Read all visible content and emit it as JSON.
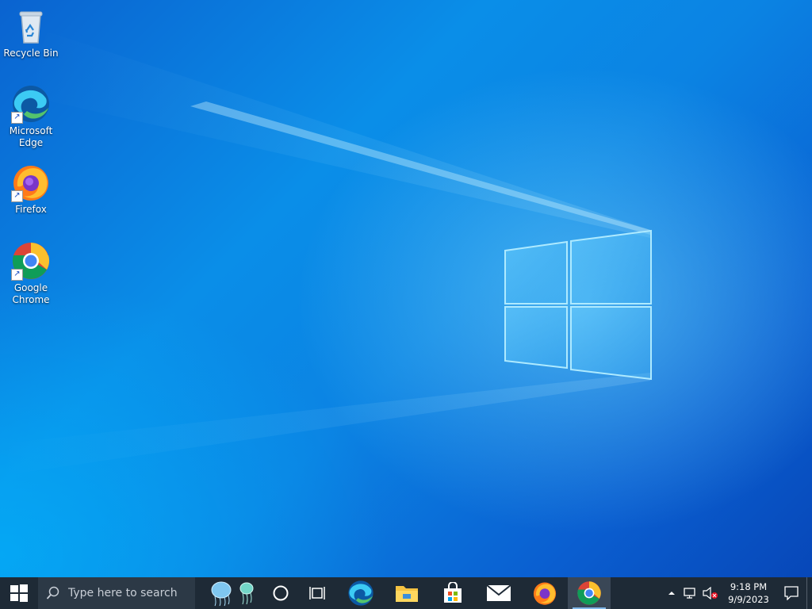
{
  "desktop": {
    "icons": [
      {
        "label_line1": "Recycle Bin",
        "label_line2": "",
        "icon": "recycle-bin-icon"
      },
      {
        "label_line1": "Microsoft",
        "label_line2": "Edge",
        "icon": "edge-icon"
      },
      {
        "label_line1": "Firefox",
        "label_line2": "",
        "icon": "firefox-icon"
      },
      {
        "label_line1": "Google",
        "label_line2": "Chrome",
        "icon": "chrome-icon"
      }
    ]
  },
  "taskbar": {
    "start_icon": "windows-start-icon",
    "search_placeholder": "Type here to search",
    "pinned": [
      "cortana-icon",
      "task-view-icon",
      "edge-icon",
      "file-explorer-icon",
      "microsoft-store-icon",
      "mail-icon",
      "firefox-icon",
      "chrome-icon"
    ],
    "active_app": "chrome-icon",
    "colors": {
      "taskbar_bg": "#1e2a36",
      "search_bg": "#2c3946",
      "active_indicator": "#7fb6e8"
    }
  },
  "tray": {
    "time": "9:18 PM",
    "date": "9/9/2023",
    "icons": [
      "show-hidden-icons-chevron",
      "network-icon",
      "volume-muted-icon",
      "notifications-icon"
    ]
  }
}
